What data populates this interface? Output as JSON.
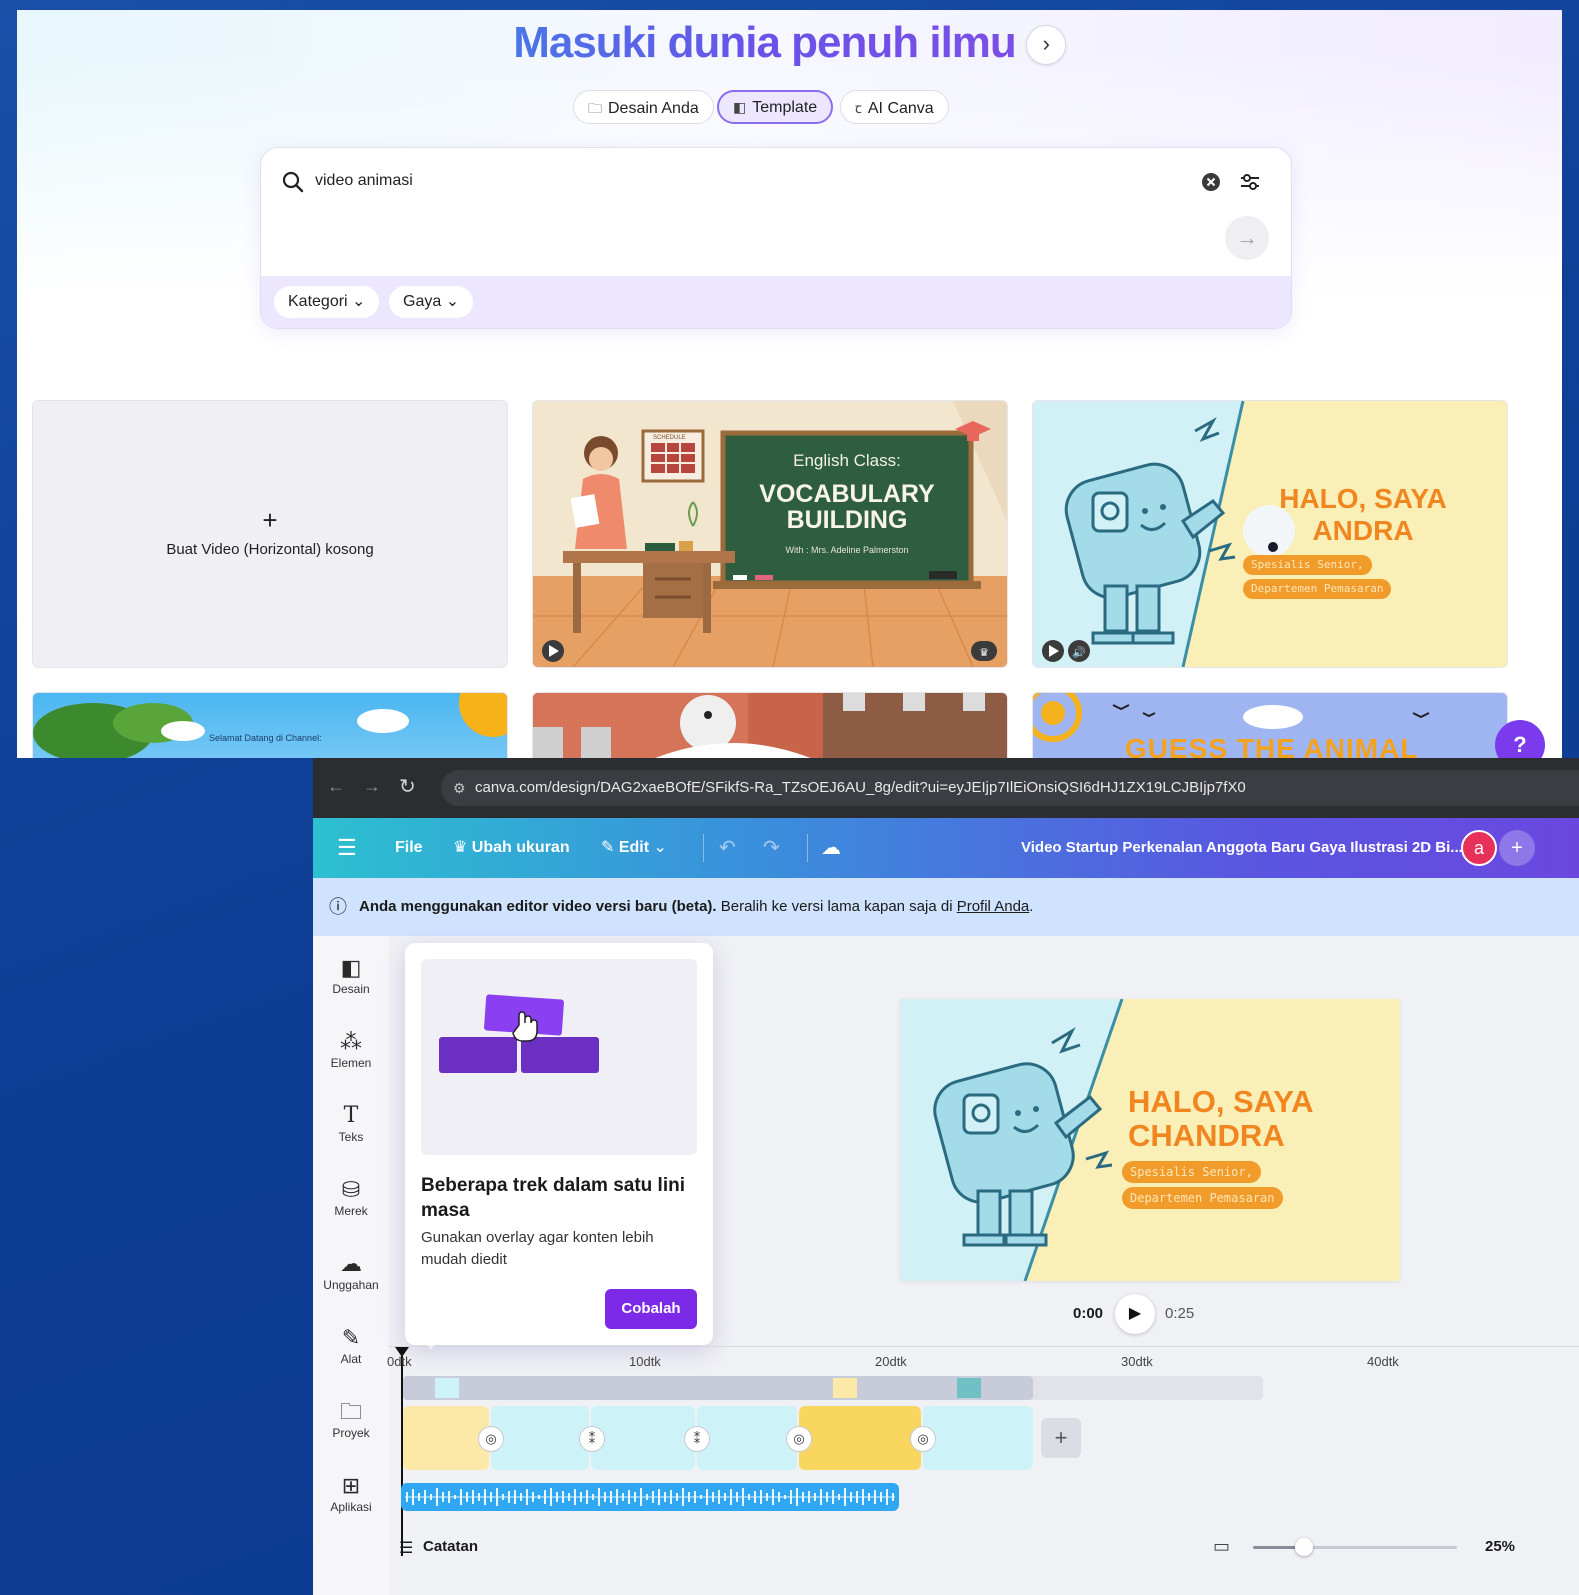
{
  "home": {
    "hero_title": "Masuki dunia penuh ilmu",
    "hero_arrow": "›",
    "tabs": [
      {
        "label": "Desain Anda",
        "icon": "folder-icon"
      },
      {
        "label": "Template",
        "icon": "template-icon"
      },
      {
        "label": "AI Canva",
        "icon": "ai-icon"
      }
    ],
    "search": {
      "value": "video animasi"
    },
    "filters": [
      "Kategori",
      "Gaya"
    ],
    "empty_card_label": "Buat Video (Horizontal) kosong",
    "template1": {
      "heading": "English Class:",
      "title_line1": "VOCABULARY",
      "title_line2": "BUILDING",
      "byline": "With : Mrs. Adeline Palmerston",
      "board_sign": "SCHEDULE"
    },
    "template2": {
      "title_line1": "HALO, SAYA",
      "title_line2": "ANDRA",
      "tag1": "Spesialis Senior,",
      "tag2": "Departemen Pemasaran"
    },
    "row2": {
      "card1_text": "Selamat Datang di Channel:",
      "card3_text": "GUESS THE ANIMAL",
      "help": "?"
    }
  },
  "editor": {
    "url": "canva.com/design/DAG2xaeBOfE/SFikfS-Ra_TZsOEJ6AU_8g/edit?ui=eyJEIjp7IlEiOnsiQSI6dHJ1ZX19LCJBIjp7fX0",
    "toolbar": {
      "file": "File",
      "resize": "Ubah ukuran",
      "edit": "Edit",
      "title": "Video Startup Perkenalan Anggota Baru Gaya Ilustrasi 2D Bi...",
      "avatar": "a",
      "add": "+"
    },
    "banner": {
      "bold": "Anda menggunakan editor video versi baru (beta).",
      "rest": "Beralih ke versi lama kapan saja di",
      "link": "Profil Anda",
      "end": "."
    },
    "sidebar": [
      "Desain",
      "Elemen",
      "Teks",
      "Merek",
      "Unggahan",
      "Alat",
      "Proyek",
      "Aplikasi"
    ],
    "popover": {
      "title": "Beberapa trek dalam satu lini masa",
      "body": "Gunakan overlay agar konten lebih mudah diedit",
      "cta": "Cobalah"
    },
    "canvas": {
      "title_line1": "HALO, SAYA",
      "title_line2": "CHANDRA",
      "tag1": "Spesialis Senior,",
      "tag2": "Departemen Pemasaran"
    },
    "player": {
      "current": "0:00",
      "total": "0:25"
    },
    "ruler": [
      "0dtk",
      "10dtk",
      "20dtk",
      "30dtk",
      "40dtk"
    ],
    "notes": "Catatan",
    "zoom": "25%",
    "zoom_level": 0.25
  },
  "colors": {
    "accent_purple": "#7d2ae8",
    "toolbar_start": "#2cc0d0",
    "toolbar_end": "#6a48e0",
    "clip_cyan": "#cdf3f8",
    "clip_yellow": "#fce9a8",
    "clip_gold": "#f9d660"
  }
}
